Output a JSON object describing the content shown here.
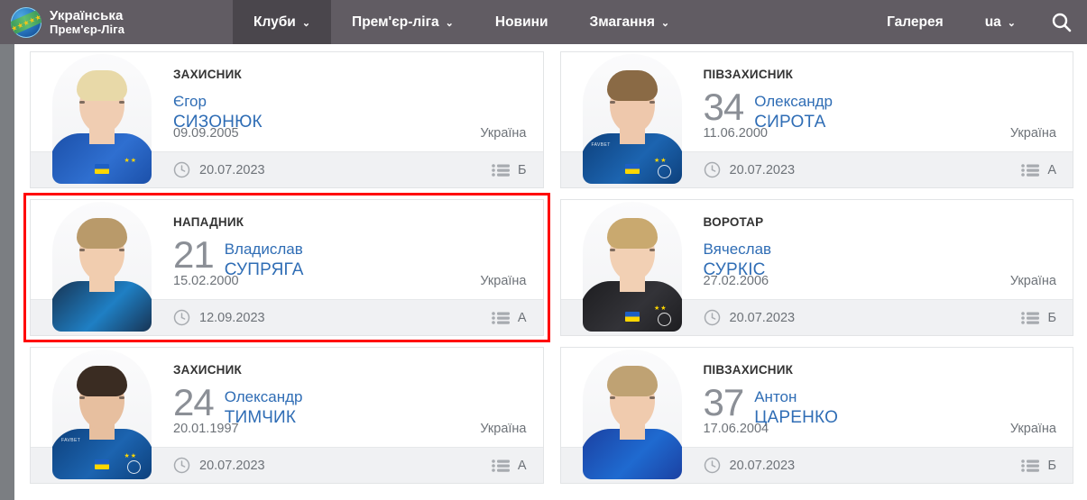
{
  "header": {
    "brand": {
      "line1": "Українська",
      "line2": "Прем'єр-Ліга",
      "logo_icon": "upl-globe-logo-icon"
    },
    "nav": [
      {
        "label": "Клуби",
        "has_caret": true,
        "active": true
      },
      {
        "label": "Прем'єр-ліга",
        "has_caret": true,
        "active": false
      },
      {
        "label": "Новини",
        "has_caret": false,
        "active": false
      },
      {
        "label": "Змагання",
        "has_caret": true,
        "active": false
      },
      {
        "label": "Галерея",
        "has_caret": false,
        "active": false
      },
      {
        "label": "ua",
        "has_caret": true,
        "active": false
      }
    ],
    "caret_glyph": "⌄",
    "search_icon": "search-icon",
    "bar_color": "#615c63",
    "active_tab_color": "#4a464c"
  },
  "colors": {
    "highlight_border": "#ff0000",
    "name_link": "#2f6db5",
    "jersey_number": "#8b8f96",
    "meta_text": "#6d7278",
    "card_footer_bg": "#f0f1f3"
  },
  "cards": [
    {
      "position": "ЗАХИСНИК",
      "number": "",
      "first_name": "Єгор",
      "last_name": "СИЗОНЮК",
      "birthdate": "09.09.2005",
      "country": "Україна",
      "joined_date": "20.07.2023",
      "squad": "Б",
      "clock_icon": "clock-icon",
      "list_icon": "list-icon",
      "highlighted": false,
      "photo": {
        "hair": "#e8d9a8",
        "skin": "#f0cdb2",
        "kit": "#1b4fa8",
        "kit2": "#2f6fd0",
        "sponsor": "",
        "flag": true,
        "stars": "★★",
        "badge": false
      }
    },
    {
      "position": "ПІВЗАХИСНИК",
      "number": "34",
      "first_name": "Олександр",
      "last_name": "СИРОТА",
      "birthdate": "11.06.2000",
      "country": "Україна",
      "joined_date": "20.07.2023",
      "squad": "А",
      "clock_icon": "clock-icon",
      "list_icon": "list-icon",
      "highlighted": false,
      "photo": {
        "hair": "#8a6a45",
        "skin": "#eec8ac",
        "kit": "#0d3f7a",
        "kit2": "#1c64b0",
        "sponsor": "FAVBET",
        "flag": true,
        "stars": "★★",
        "badge": true
      }
    },
    {
      "position": "НАПАДНИК",
      "number": "21",
      "first_name": "Владислав",
      "last_name": "СУПРЯГА",
      "birthdate": "15.02.2000",
      "country": "Україна",
      "joined_date": "12.09.2023",
      "squad": "А",
      "clock_icon": "clock-icon",
      "list_icon": "list-icon",
      "highlighted": true,
      "photo": {
        "hair": "#b99a6a",
        "skin": "#f1cdaf",
        "kit": "#17314f",
        "kit2": "#1f7fc4",
        "sponsor": "",
        "flag": false,
        "stars": "",
        "badge": false
      }
    },
    {
      "position": "ВОРОТАР",
      "number": "",
      "first_name": "Вячеслав",
      "last_name": "СУРКІС",
      "birthdate": "27.02.2006",
      "country": "Україна",
      "joined_date": "20.07.2023",
      "squad": "Б",
      "clock_icon": "clock-icon",
      "list_icon": "list-icon",
      "highlighted": false,
      "photo": {
        "hair": "#c9a96f",
        "skin": "#f2d0b4",
        "kit": "#1d1d20",
        "kit2": "#333338",
        "sponsor": "",
        "flag": true,
        "stars": "★★",
        "badge": true
      }
    },
    {
      "position": "ЗАХИСНИК",
      "number": "24",
      "first_name": "Олександр",
      "last_name": "ТИМЧИК",
      "birthdate": "20.01.1997",
      "country": "Україна",
      "joined_date": "20.07.2023",
      "squad": "А",
      "clock_icon": "clock-icon",
      "list_icon": "list-icon",
      "highlighted": false,
      "photo": {
        "hair": "#3a2c22",
        "skin": "#e7bf9f",
        "kit": "#0d3f7a",
        "kit2": "#1c64b0",
        "sponsor": "FAVBET",
        "flag": true,
        "stars": "★★",
        "badge": true
      }
    },
    {
      "position": "ПІВЗАХИСНИК",
      "number": "37",
      "first_name": "Антон",
      "last_name": "ЦАРЕНКО",
      "birthdate": "17.06.2004",
      "country": "Україна",
      "joined_date": "20.07.2023",
      "squad": "Б",
      "clock_icon": "clock-icon",
      "list_icon": "list-icon",
      "highlighted": false,
      "photo": {
        "hair": "#bfa273",
        "skin": "#f0cbae",
        "kit": "#1b3fa0",
        "kit2": "#1f6ad0",
        "sponsor": "",
        "flag": false,
        "stars": "",
        "badge": false
      }
    }
  ]
}
